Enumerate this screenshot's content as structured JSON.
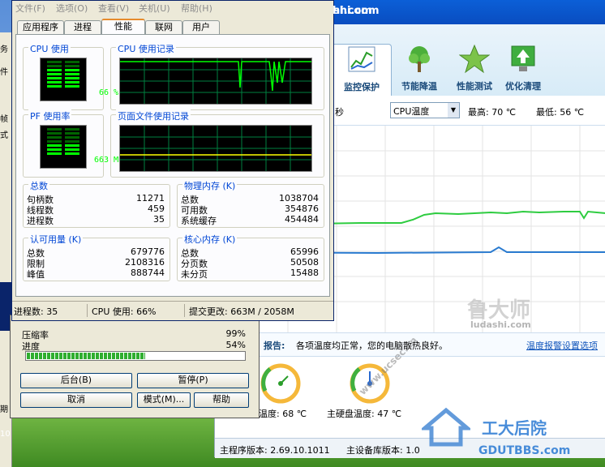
{
  "desktop": {
    "site_label": "hi.com",
    "left_strip_chars": [
      "务",
      "件",
      "帧",
      "式",
      "10",
      "期"
    ]
  },
  "task_manager": {
    "menu": [
      "文件(F)",
      "选项(O)",
      "查看(V)",
      "关机(U)",
      "帮助(H)"
    ],
    "tabs": [
      "应用程序",
      "进程",
      "性能",
      "联网",
      "用户"
    ],
    "cpu_usage": {
      "title": "CPU 使用",
      "value": "66 %"
    },
    "cpu_history": {
      "title": "CPU 使用记录"
    },
    "pf_usage": {
      "title": "PF 使用率",
      "value": "663 MB"
    },
    "pf_history": {
      "title": "页面文件使用记录"
    },
    "totals": {
      "title": "总数",
      "rows": [
        {
          "label": "句柄数",
          "value": "11271"
        },
        {
          "label": "线程数",
          "value": "459"
        },
        {
          "label": "进程数",
          "value": "35"
        }
      ]
    },
    "physical": {
      "title": "物理内存 (K)",
      "rows": [
        {
          "label": "总数",
          "value": "1038704"
        },
        {
          "label": "可用数",
          "value": "354876"
        },
        {
          "label": "系统缓存",
          "value": "454484"
        }
      ]
    },
    "commit": {
      "title": "认可用量 (K)",
      "rows": [
        {
          "label": "总数",
          "value": "679776"
        },
        {
          "label": "限制",
          "value": "2108316"
        },
        {
          "label": "峰值",
          "value": "888744"
        }
      ]
    },
    "kernel": {
      "title": "核心内存 (K)",
      "rows": [
        {
          "label": "总数",
          "value": "65996"
        },
        {
          "label": "分页数",
          "value": "50508"
        },
        {
          "label": "未分页",
          "value": "15488"
        }
      ]
    },
    "status": {
      "processes": "进程数: 35",
      "cpu": "CPU 使用: 66%",
      "commit": "提交更改: 663M / 2058M"
    }
  },
  "copy_dialog": {
    "ratio_label": "压缩率",
    "ratio_value": "99%",
    "progress_label": "进度",
    "progress_value": "54%",
    "progress_fraction": 0.54,
    "buttons": {
      "background": "后台(B)",
      "pause": "暂停(P)",
      "cancel": "取消",
      "mode": "模式(M)...",
      "help": "帮助"
    }
  },
  "ludashi": {
    "title": "shi.com",
    "tools": [
      {
        "label": "监控保护"
      },
      {
        "label": "节能降温"
      },
      {
        "label": "性能测试"
      },
      {
        "label": "优化清理"
      }
    ],
    "controls": {
      "seconds": "秒",
      "sensor": "CPU温度",
      "max": "最高: 70 ℃",
      "min": "最低: 56 ℃"
    },
    "report_title": "报告:",
    "report_text": "各项温度均正常，您的电脑散热良好。",
    "alarm_link": "温度报警设置选项",
    "gauges": [
      {
        "label": "温度: 68 ℃",
        "value": 68
      },
      {
        "label": "主硬盘温度: 47 ℃",
        "value": 47
      }
    ],
    "status": {
      "program": "主程序版本: 2.69.10.1011",
      "library": "主设备库版本: 1.0"
    }
  },
  "watermarks": {
    "ludashi_brand": "鲁大师",
    "ludashi_url": "ludashi.com",
    "bbs": "工大后院",
    "bbs_url": "GDUTBBS.com",
    "slant": "www.ucsec.cn"
  },
  "colors": {
    "graph_green": "#2ecc40",
    "graph_blue": "#2a7bd0",
    "monitor_green": "#00ff00"
  }
}
